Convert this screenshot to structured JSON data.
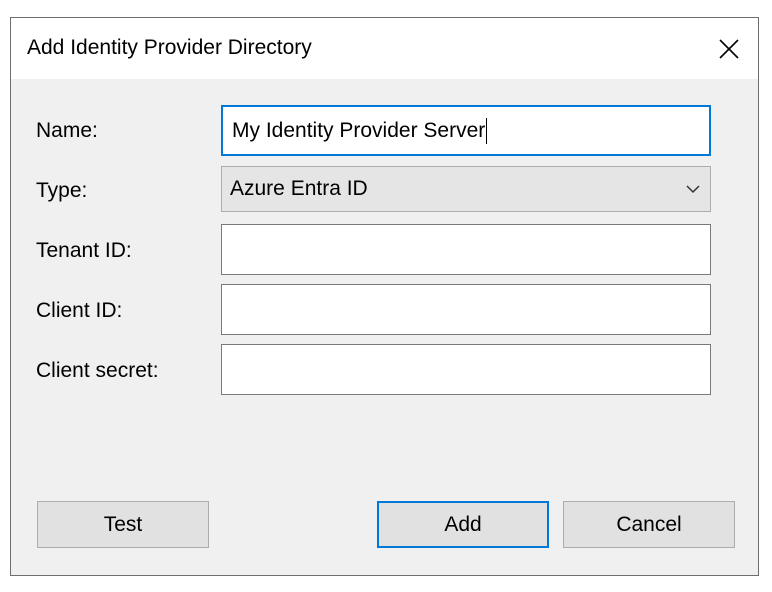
{
  "window": {
    "title": "Add Identity Provider Directory",
    "close_icon": "close-icon"
  },
  "form": {
    "name": {
      "label": "Name:",
      "value": "My Identity Provider Server"
    },
    "type": {
      "label": "Type:",
      "selected": "Azure Entra ID",
      "dropdown_icon": "chevron-down-icon"
    },
    "tenant_id": {
      "label": "Tenant ID:",
      "value": ""
    },
    "client_id": {
      "label": "Client ID:",
      "value": ""
    },
    "client_secret": {
      "label": "Client secret:",
      "value": ""
    }
  },
  "buttons": {
    "test": "Test",
    "add": "Add",
    "cancel": "Cancel"
  },
  "colors": {
    "focus_accent": "#0078d7",
    "dialog_bg": "#f0f0f0",
    "button_bg": "#e1e1e1"
  }
}
